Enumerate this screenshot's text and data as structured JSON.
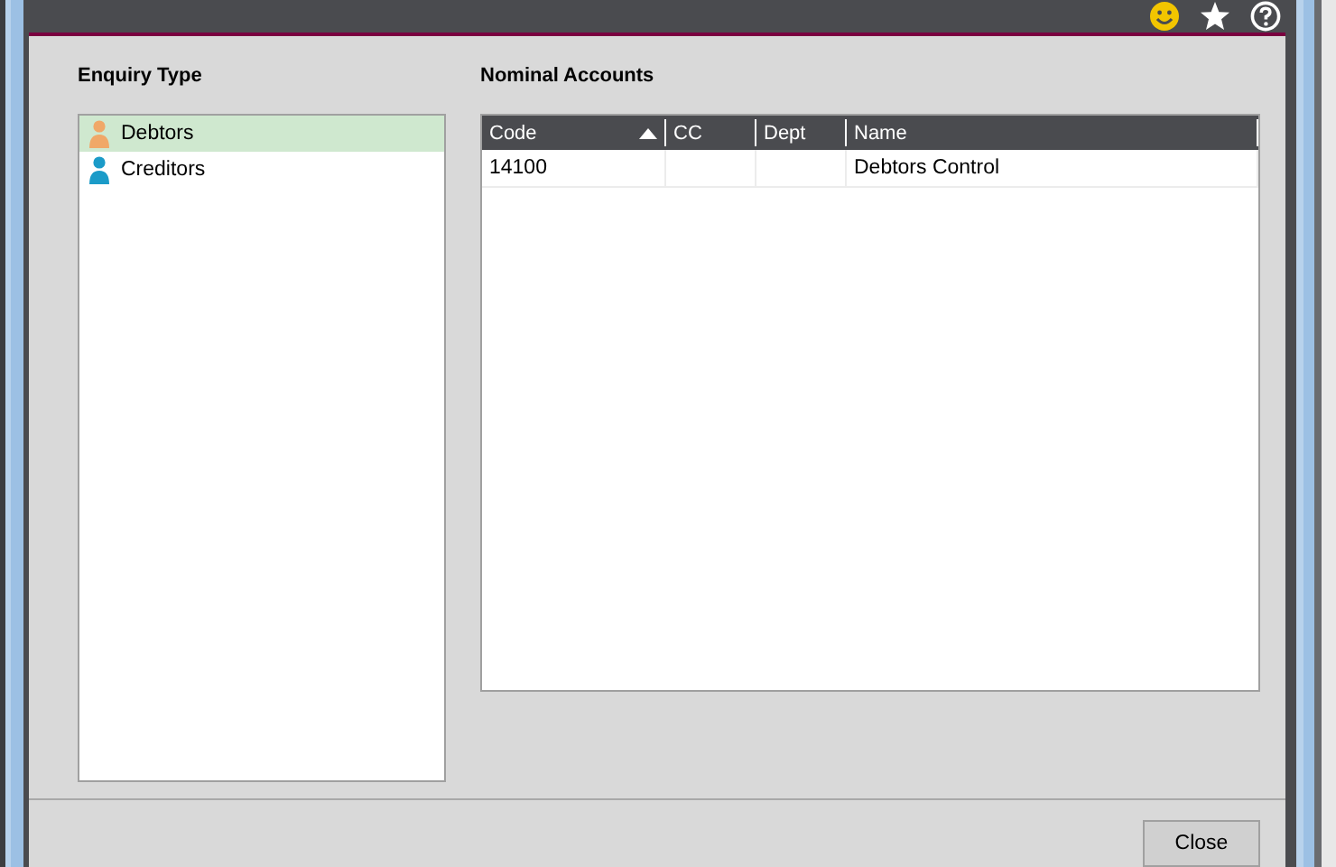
{
  "enquiry_type": {
    "label": "Enquiry Type",
    "items": [
      {
        "label": "Debtors",
        "kind": "debtor",
        "selected": true
      },
      {
        "label": "Creditors",
        "kind": "creditor",
        "selected": false
      }
    ]
  },
  "nominal_accounts": {
    "label": "Nominal Accounts",
    "columns": [
      {
        "label": "Code",
        "sorted": true
      },
      {
        "label": "CC"
      },
      {
        "label": "Dept"
      },
      {
        "label": "Name"
      }
    ],
    "rows": [
      {
        "code": "14100",
        "name": "Debtors Control"
      }
    ]
  },
  "buttons": [
    {
      "label": "Close"
    }
  ]
}
